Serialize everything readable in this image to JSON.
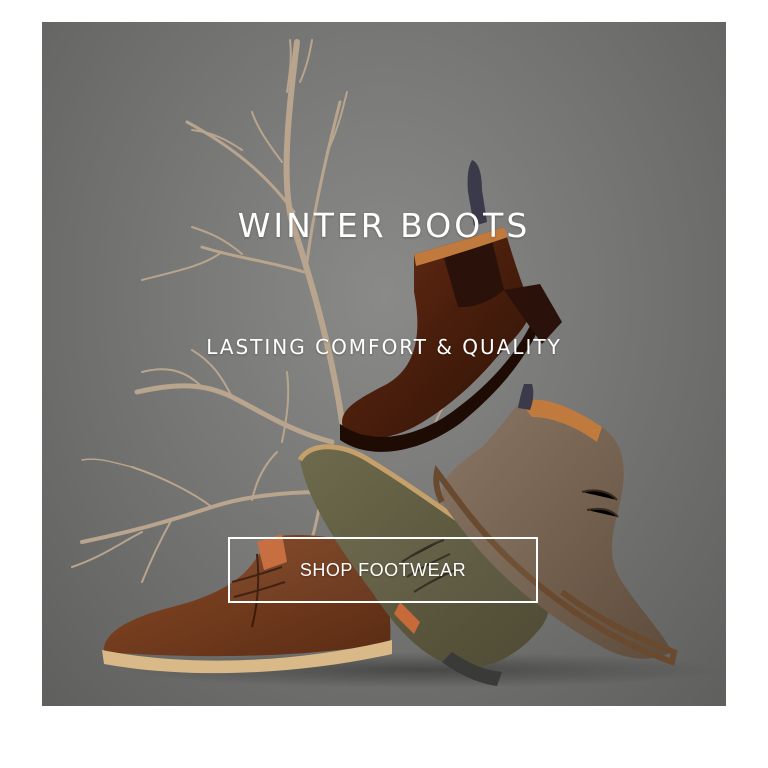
{
  "banner": {
    "headline": "WINTER BOOTS",
    "subheadline": "LASTING COMFORT & QUALITY",
    "cta_label": "SHOP FOOTWEAR",
    "background_color": "#777776",
    "text_color": "#ffffff"
  },
  "visuals": {
    "branch": "bare-branch-illustration",
    "boots": [
      "chelsea-boot-dark-brown",
      "suede-chukka-boot-taupe",
      "suede-chukka-boot-olive",
      "leather-chukka-boot-brown"
    ]
  }
}
